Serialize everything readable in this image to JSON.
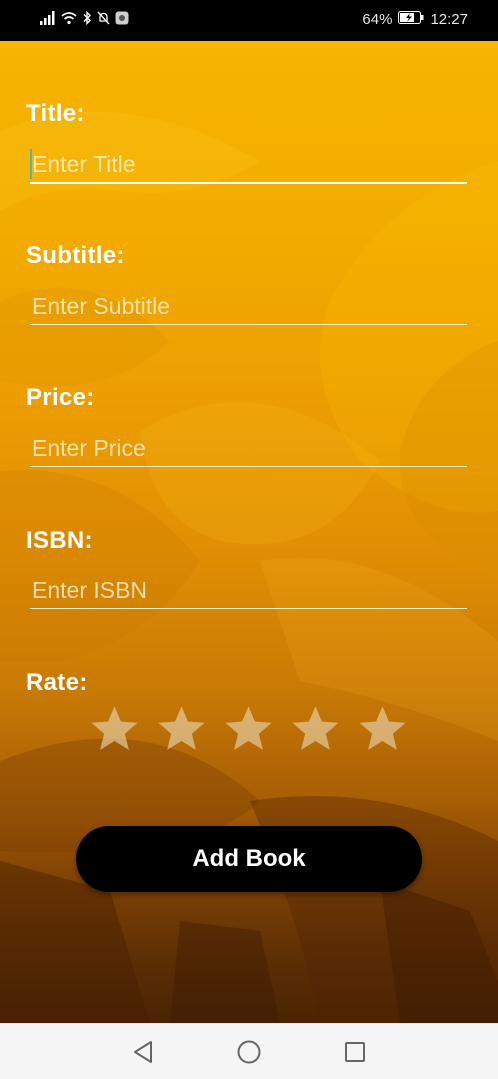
{
  "status_bar": {
    "battery_percent": "64%",
    "time": "12:27",
    "icons": [
      "signal-icon",
      "wifi-icon",
      "bluetooth-icon",
      "notifications-off-icon",
      "app-notification-icon",
      "battery-charging-icon"
    ]
  },
  "form": {
    "title": {
      "label": "Title:",
      "placeholder": "Enter Title",
      "value": ""
    },
    "subtitle": {
      "label": "Subtitle:",
      "placeholder": "Enter Subtitle",
      "value": ""
    },
    "price": {
      "label": "Price:",
      "placeholder": "Enter Price",
      "value": ""
    },
    "isbn": {
      "label": "ISBN:",
      "placeholder": "Enter ISBN",
      "value": ""
    },
    "rate": {
      "label": "Rate:",
      "max_stars": 5,
      "value": 0
    }
  },
  "actions": {
    "add_book_label": "Add Book"
  },
  "colors": {
    "accent": "#F7B400",
    "button_bg": "#000000",
    "button_text": "#FFFFFF",
    "star_empty": "#E8D6B5",
    "caret": "#4FB3BF"
  },
  "nav_bar": {
    "icons": [
      "back-icon",
      "home-icon",
      "recents-icon"
    ]
  }
}
